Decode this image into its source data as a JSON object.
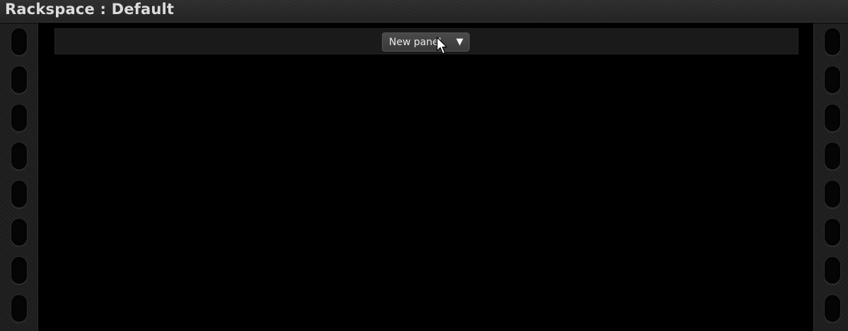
{
  "window": {
    "title": "Rackspace : Default"
  },
  "toolbar": {
    "new_panel_label": "New panel",
    "new_panel_arrow": "▼",
    "new_panel_arrow_icon": "triangle-down-icon"
  },
  "rails": {
    "hole_count": 8
  },
  "colors": {
    "background": "#000000",
    "titlebar": "#262626",
    "rail": "#1e1e1e",
    "toolbar": "#1a1a1a",
    "button": "#424242",
    "text": "#dcdcdc"
  }
}
